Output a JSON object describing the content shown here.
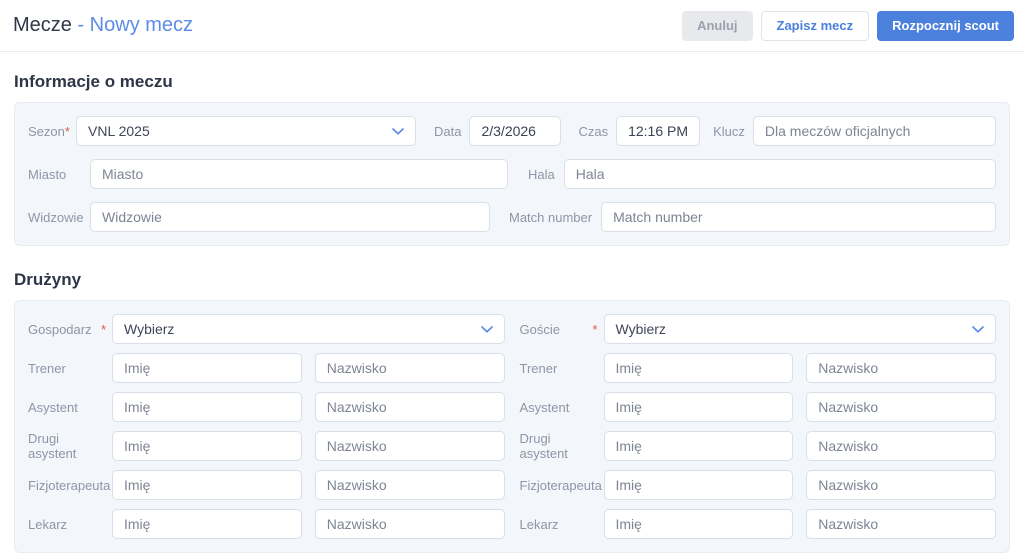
{
  "colors": {
    "accent_blue": "#4c80dd",
    "title_blue": "#5d8ce8",
    "required_red": "#e4584a",
    "panel_bg": "#f3f6fa"
  },
  "header": {
    "title": "Mecze",
    "subtitle": "- Nowy mecz",
    "buttons": {
      "cancel": "Anuluj",
      "save": "Zapisz mecz",
      "start_scout": "Rozpocznij scout"
    }
  },
  "match_info": {
    "heading": "Informacje o meczu",
    "required_marker": "*",
    "season": {
      "label": "Sezon",
      "value": "VNL 2025"
    },
    "date": {
      "label": "Data",
      "value": "2/3/2026"
    },
    "time": {
      "label": "Czas",
      "value": "12:16 PM"
    },
    "key": {
      "label": "Klucz",
      "placeholder": "Dla meczów oficjalnych"
    },
    "city": {
      "label": "Miasto",
      "placeholder": "Miasto"
    },
    "hall": {
      "label": "Hala",
      "placeholder": "Hala"
    },
    "spectators": {
      "label": "Widzowie",
      "placeholder": "Widzowie"
    },
    "match_number": {
      "label": "Match number",
      "placeholder": "Match number"
    }
  },
  "teams": {
    "heading": "Drużyny",
    "required_marker": "*",
    "home": {
      "label": "Gospodarz",
      "select_value": "Wybierz"
    },
    "away": {
      "label": "Goście",
      "select_value": "Wybierz"
    },
    "roles": {
      "coach": "Trener",
      "assistant": "Asystent",
      "second_assistant": "Drugi asystent",
      "physiotherapist": "Fizjoterapeuta",
      "doctor": "Lekarz"
    },
    "first_name_placeholder": "Imię",
    "last_name_placeholder": "Nazwisko"
  }
}
